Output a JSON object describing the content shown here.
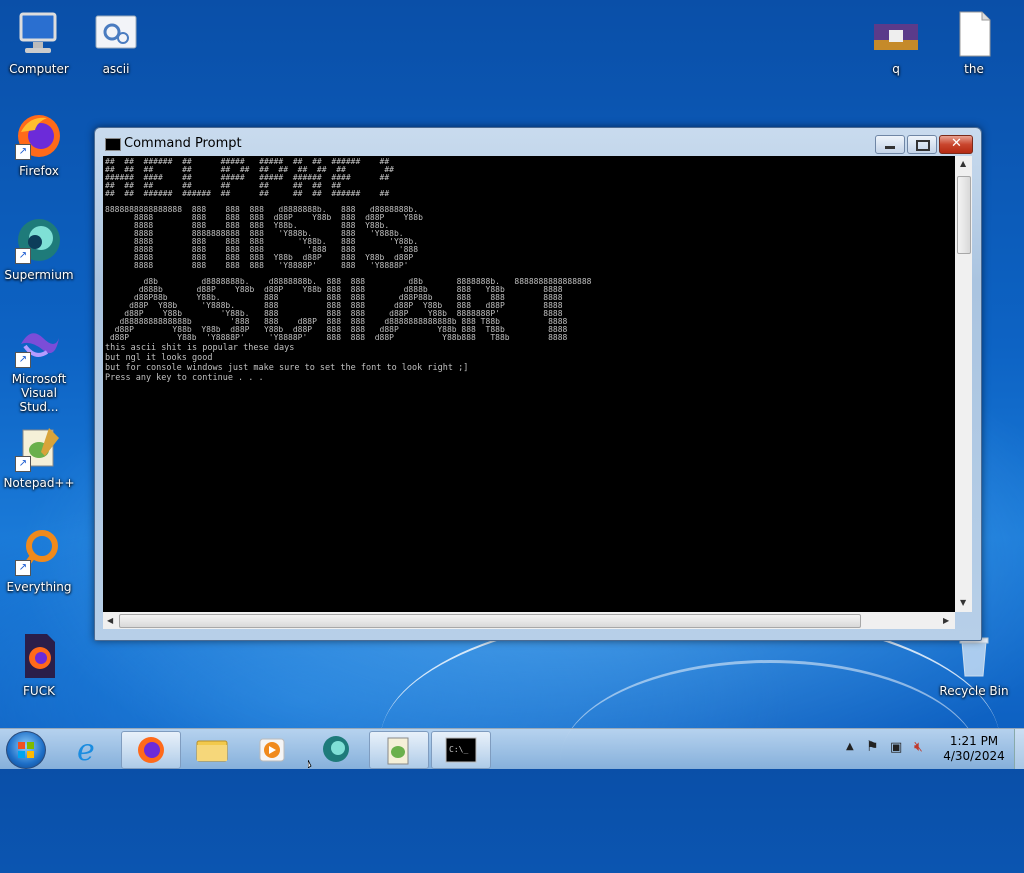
{
  "desktop": {
    "icons": [
      {
        "label": "Computer"
      },
      {
        "label": "ascii"
      },
      {
        "label": "q"
      },
      {
        "label": "the"
      },
      {
        "label": "Firefox"
      },
      {
        "label": "Supermium"
      },
      {
        "label": "Microsoft Visual Stud..."
      },
      {
        "label": "Notepad++"
      },
      {
        "label": "Everything"
      },
      {
        "label": "FUCK"
      },
      {
        "label": "Recycle Bin"
      }
    ]
  },
  "window": {
    "title": "Command Prompt",
    "ascii_art": "##  ##  ######  ##      #####   #####  ##  ##  ######    ##\n##  ##  ##      ##      ##  ##  ##  ##  ##  ##  ##        ##\n######  ####    ##      #####   #####  ######  ####      ##\n##  ##  ##      ##      ##      ##     ##  ##  ##        \n##  ##  ######  ######  ##      ##     ##  ##  ######    ##\n\n8888888888888888  888    888  888   d8888888b.   888   d8888888b.\n      8888        888    888  888  d88P    Y88b  888  d88P    Y88b\n      8888        888    888  888  Y88b.         888  Y88b.\n      8888        8888888888  888   'Y888b.      888   'Y888b.\n      8888        888    888  888       'Y88b.   888       'Y88b.\n      8888        888    888  888         '888   888         '888\n      8888        888    888  888  Y88b  d88P    888  Y88b  d88P\n      8888        888    888  888   'Y8888P'     888   'Y8888P'\n\n        d8b         d8888888b.    d8888888b.  888  888         d8b       8888888b.   8888888888888888\n       d888b       d88P    Y88b  d88P    Y88b 888  888        d888b      888   Y88b        8888\n      d88P88b      Y88b.         888          888  888       d88P88b     888    888        8888\n     d88P  Y88b     'Y888b.      888          888  888      d88P  Y88b   888   d88P        8888\n    d88P    Y88b        'Y88b.   888          888  888     d88P    Y88b  8888888P'         8888\n   d8888888888888b        '888   888    d88P  888  888    d8888888888888b 888 T88b          8888\n  d88P        Y88b  Y88b  d88P   Y88b  d88P   888  888   d88P        Y88b 888  T88b         8888\n d88P          Y88b  'Y8888P'     'Y8888P'    888  888  d88P          Y88b888   T88b        8888",
    "lines": [
      "this ascii shit is popular these days",
      "but ngl it looks good",
      "but for console windows just make sure to set the font to look right ;]",
      "Press any key to continue . . ."
    ]
  },
  "taskbar": {
    "time": "1:21 PM",
    "date": "4/30/2024"
  }
}
